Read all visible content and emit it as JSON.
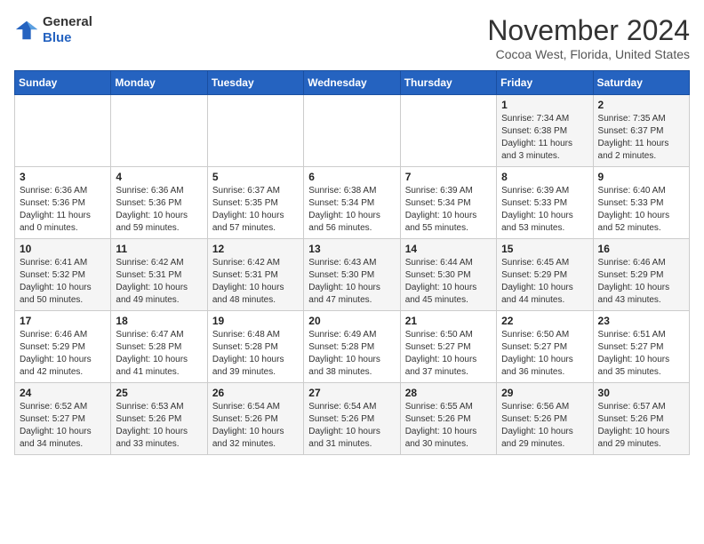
{
  "header": {
    "logo_line1": "General",
    "logo_line2": "Blue",
    "month": "November 2024",
    "location": "Cocoa West, Florida, United States"
  },
  "weekdays": [
    "Sunday",
    "Monday",
    "Tuesday",
    "Wednesday",
    "Thursday",
    "Friday",
    "Saturday"
  ],
  "rows": [
    [
      {
        "day": "",
        "info": ""
      },
      {
        "day": "",
        "info": ""
      },
      {
        "day": "",
        "info": ""
      },
      {
        "day": "",
        "info": ""
      },
      {
        "day": "",
        "info": ""
      },
      {
        "day": "1",
        "info": "Sunrise: 7:34 AM\nSunset: 6:38 PM\nDaylight: 11 hours\nand 3 minutes."
      },
      {
        "day": "2",
        "info": "Sunrise: 7:35 AM\nSunset: 6:37 PM\nDaylight: 11 hours\nand 2 minutes."
      }
    ],
    [
      {
        "day": "3",
        "info": "Sunrise: 6:36 AM\nSunset: 5:36 PM\nDaylight: 11 hours\nand 0 minutes."
      },
      {
        "day": "4",
        "info": "Sunrise: 6:36 AM\nSunset: 5:36 PM\nDaylight: 10 hours\nand 59 minutes."
      },
      {
        "day": "5",
        "info": "Sunrise: 6:37 AM\nSunset: 5:35 PM\nDaylight: 10 hours\nand 57 minutes."
      },
      {
        "day": "6",
        "info": "Sunrise: 6:38 AM\nSunset: 5:34 PM\nDaylight: 10 hours\nand 56 minutes."
      },
      {
        "day": "7",
        "info": "Sunrise: 6:39 AM\nSunset: 5:34 PM\nDaylight: 10 hours\nand 55 minutes."
      },
      {
        "day": "8",
        "info": "Sunrise: 6:39 AM\nSunset: 5:33 PM\nDaylight: 10 hours\nand 53 minutes."
      },
      {
        "day": "9",
        "info": "Sunrise: 6:40 AM\nSunset: 5:33 PM\nDaylight: 10 hours\nand 52 minutes."
      }
    ],
    [
      {
        "day": "10",
        "info": "Sunrise: 6:41 AM\nSunset: 5:32 PM\nDaylight: 10 hours\nand 50 minutes."
      },
      {
        "day": "11",
        "info": "Sunrise: 6:42 AM\nSunset: 5:31 PM\nDaylight: 10 hours\nand 49 minutes."
      },
      {
        "day": "12",
        "info": "Sunrise: 6:42 AM\nSunset: 5:31 PM\nDaylight: 10 hours\nand 48 minutes."
      },
      {
        "day": "13",
        "info": "Sunrise: 6:43 AM\nSunset: 5:30 PM\nDaylight: 10 hours\nand 47 minutes."
      },
      {
        "day": "14",
        "info": "Sunrise: 6:44 AM\nSunset: 5:30 PM\nDaylight: 10 hours\nand 45 minutes."
      },
      {
        "day": "15",
        "info": "Sunrise: 6:45 AM\nSunset: 5:29 PM\nDaylight: 10 hours\nand 44 minutes."
      },
      {
        "day": "16",
        "info": "Sunrise: 6:46 AM\nSunset: 5:29 PM\nDaylight: 10 hours\nand 43 minutes."
      }
    ],
    [
      {
        "day": "17",
        "info": "Sunrise: 6:46 AM\nSunset: 5:29 PM\nDaylight: 10 hours\nand 42 minutes."
      },
      {
        "day": "18",
        "info": "Sunrise: 6:47 AM\nSunset: 5:28 PM\nDaylight: 10 hours\nand 41 minutes."
      },
      {
        "day": "19",
        "info": "Sunrise: 6:48 AM\nSunset: 5:28 PM\nDaylight: 10 hours\nand 39 minutes."
      },
      {
        "day": "20",
        "info": "Sunrise: 6:49 AM\nSunset: 5:28 PM\nDaylight: 10 hours\nand 38 minutes."
      },
      {
        "day": "21",
        "info": "Sunrise: 6:50 AM\nSunset: 5:27 PM\nDaylight: 10 hours\nand 37 minutes."
      },
      {
        "day": "22",
        "info": "Sunrise: 6:50 AM\nSunset: 5:27 PM\nDaylight: 10 hours\nand 36 minutes."
      },
      {
        "day": "23",
        "info": "Sunrise: 6:51 AM\nSunset: 5:27 PM\nDaylight: 10 hours\nand 35 minutes."
      }
    ],
    [
      {
        "day": "24",
        "info": "Sunrise: 6:52 AM\nSunset: 5:27 PM\nDaylight: 10 hours\nand 34 minutes."
      },
      {
        "day": "25",
        "info": "Sunrise: 6:53 AM\nSunset: 5:26 PM\nDaylight: 10 hours\nand 33 minutes."
      },
      {
        "day": "26",
        "info": "Sunrise: 6:54 AM\nSunset: 5:26 PM\nDaylight: 10 hours\nand 32 minutes."
      },
      {
        "day": "27",
        "info": "Sunrise: 6:54 AM\nSunset: 5:26 PM\nDaylight: 10 hours\nand 31 minutes."
      },
      {
        "day": "28",
        "info": "Sunrise: 6:55 AM\nSunset: 5:26 PM\nDaylight: 10 hours\nand 30 minutes."
      },
      {
        "day": "29",
        "info": "Sunrise: 6:56 AM\nSunset: 5:26 PM\nDaylight: 10 hours\nand 29 minutes."
      },
      {
        "day": "30",
        "info": "Sunrise: 6:57 AM\nSunset: 5:26 PM\nDaylight: 10 hours\nand 29 minutes."
      }
    ]
  ]
}
